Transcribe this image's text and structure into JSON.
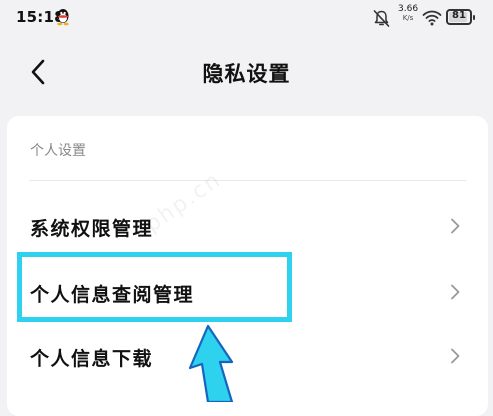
{
  "status_bar": {
    "time": "15:18",
    "net_speed_value": "3.66",
    "net_speed_unit": "K/s",
    "battery_level": "81",
    "icons": [
      "qq-icon",
      "mute-icon",
      "wifi-icon",
      "battery-icon"
    ]
  },
  "header": {
    "title": "隐私设置",
    "back_icon": "chevron-left-icon"
  },
  "section": {
    "title": "个人设置",
    "items": [
      {
        "label": "系统权限管理",
        "icon": "chevron-right-icon"
      },
      {
        "label": "个人信息查阅管理",
        "icon": "chevron-right-icon",
        "highlighted": true
      },
      {
        "label": "个人信息下载",
        "icon": "chevron-right-icon"
      }
    ]
  },
  "annotation": {
    "highlight_color": "#2ed1ee",
    "arrow_color": "#2ed1ee"
  },
  "watermark": "php.cn"
}
